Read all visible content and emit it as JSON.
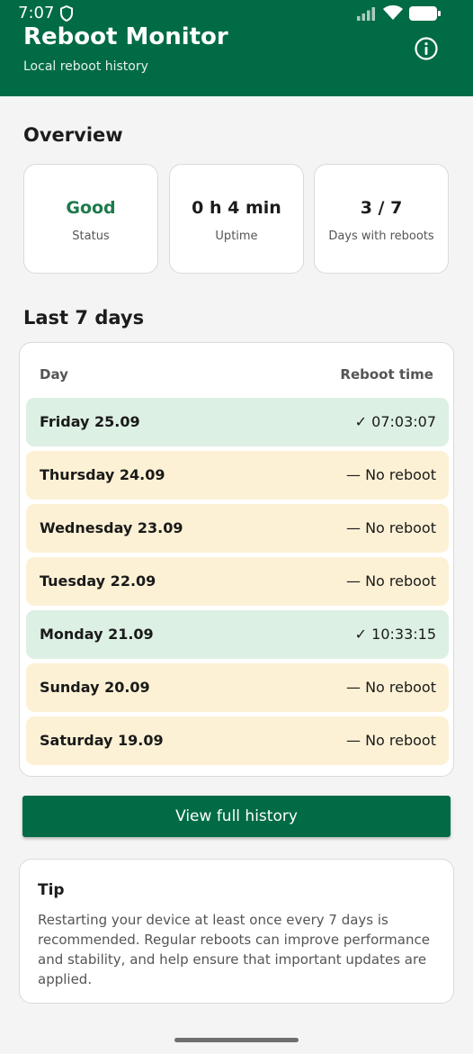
{
  "status_bar": {
    "time": "7:07"
  },
  "header": {
    "title": "Reboot Monitor",
    "subtitle": "Local reboot history"
  },
  "colors": {
    "primary": "#006b45",
    "ok_row": "#dcf0e3",
    "miss_row": "#fdf1d5",
    "good_text": "#1e7a4c"
  },
  "overview": {
    "title": "Overview",
    "cards": [
      {
        "value": "Good",
        "label": "Status"
      },
      {
        "value": "0 h 4 min",
        "label": "Uptime"
      },
      {
        "value": "3 / 7",
        "label": "Days with reboots"
      }
    ]
  },
  "last_days": {
    "title": "Last 7 days",
    "col_day": "Day",
    "col_time": "Reboot time",
    "rows": [
      {
        "day": "Friday 25.09",
        "time": "✓ 07:03:07",
        "status": "ok"
      },
      {
        "day": "Thursday 24.09",
        "time": "— No reboot",
        "status": "miss"
      },
      {
        "day": "Wednesday 23.09",
        "time": "— No reboot",
        "status": "miss"
      },
      {
        "day": "Tuesday 22.09",
        "time": "— No reboot",
        "status": "miss"
      },
      {
        "day": "Monday 21.09",
        "time": "✓ 10:33:15",
        "status": "ok"
      },
      {
        "day": "Sunday 20.09",
        "time": "— No reboot",
        "status": "miss"
      },
      {
        "day": "Saturday 19.09",
        "time": "— No reboot",
        "status": "miss"
      }
    ]
  },
  "actions": {
    "full_history": "View full history"
  },
  "tip": {
    "title": "Tip",
    "text": "Restarting your device at least once every 7 days is recommended. Regular reboots can improve performance and stability, and help ensure that important updates are applied."
  }
}
